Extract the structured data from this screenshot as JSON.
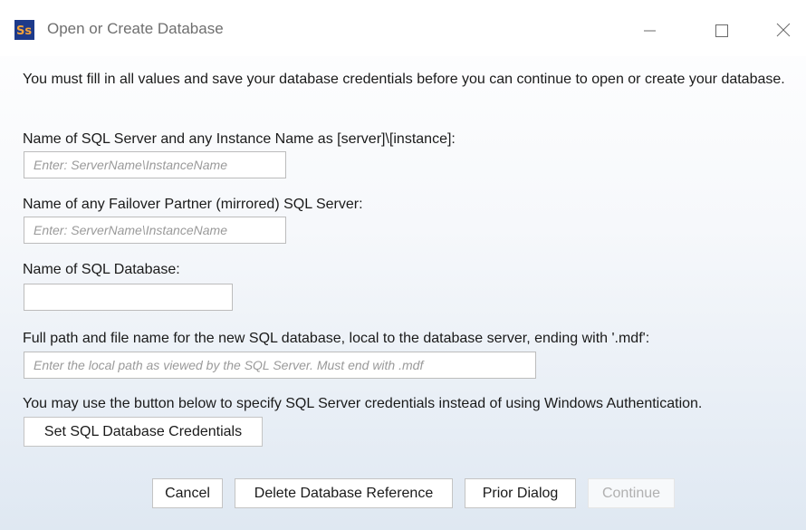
{
  "window": {
    "title": "Open or Create Database",
    "app_icon_text": "Ss"
  },
  "intro_text": "You must fill in all values and save your database credentials before you can continue to open or create your database.",
  "server": {
    "label": "Name of SQL Server and any Instance Name as [server]\\[instance]:",
    "value": "",
    "placeholder": "Enter: ServerName\\InstanceName"
  },
  "failover": {
    "label": "Name of any Failover Partner (mirrored) SQL Server:",
    "value": "",
    "placeholder": "Enter: ServerName\\InstanceName"
  },
  "database": {
    "label": "Name of SQL Database:",
    "value": "",
    "placeholder": ""
  },
  "path": {
    "label": "Full path and file name for the new SQL database, local to the database server, ending with '.mdf':",
    "value": "",
    "placeholder": "Enter the local path as viewed by the SQL Server. Must end with .mdf"
  },
  "credentials": {
    "note": "You may use the button below to specify SQL Server credentials instead of using Windows Authentication.",
    "button_label": "Set SQL Database Credentials"
  },
  "buttons": {
    "cancel": "Cancel",
    "delete_reference": "Delete Database Reference",
    "prior_dialog": "Prior Dialog",
    "continue": "Continue"
  }
}
